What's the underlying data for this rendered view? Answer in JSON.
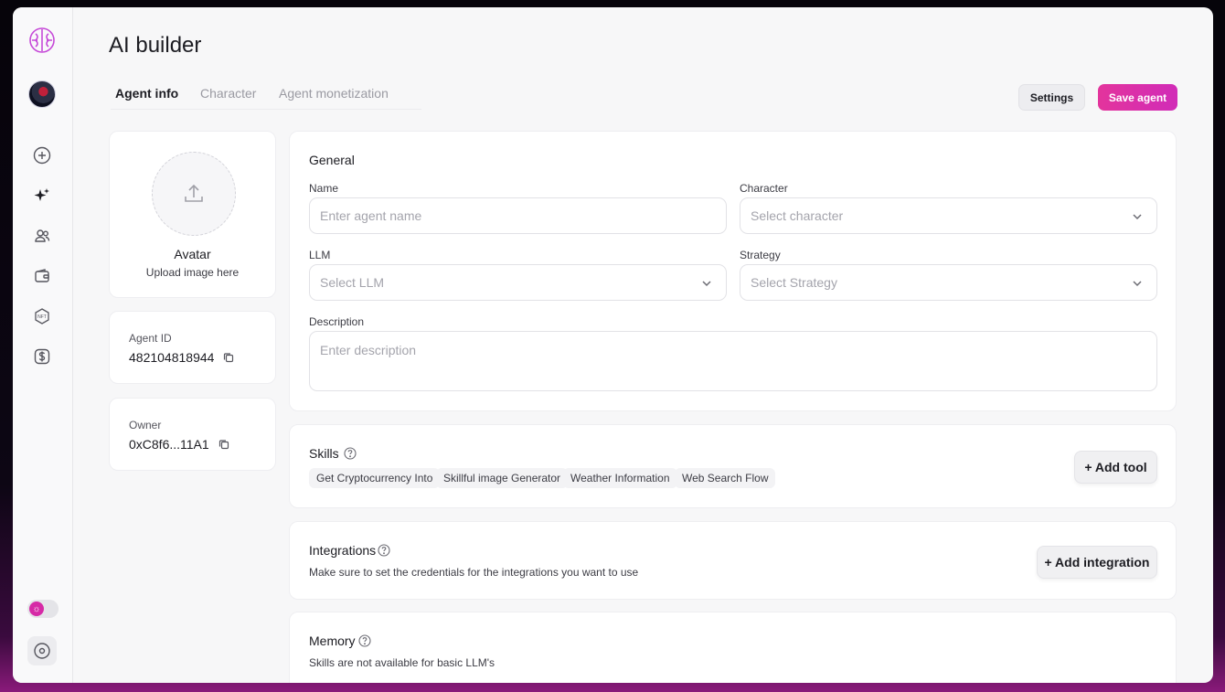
{
  "app": {
    "title": "AI builder"
  },
  "tabs": [
    {
      "label": "Agent info",
      "active": true
    },
    {
      "label": "Character",
      "active": false
    },
    {
      "label": "Agent monetization",
      "active": false
    }
  ],
  "header_buttons": {
    "settings": "Settings",
    "save": "Save agent"
  },
  "sidebar": {
    "icons": [
      "brain-logo-icon",
      "user-avatar",
      "plus-circle-icon",
      "sparkles-icon",
      "users-icon",
      "wallet-icon",
      "nft-icon",
      "dollar-icon",
      "theme-toggle",
      "settings-circle-icon"
    ]
  },
  "avatar_card": {
    "title": "Avatar",
    "subtitle": "Upload image here"
  },
  "agent_id": {
    "label": "Agent ID",
    "value": "482104818944"
  },
  "owner": {
    "label": "Owner",
    "value": "0xC8f6...11A1"
  },
  "general": {
    "title": "General",
    "name": {
      "label": "Name",
      "placeholder": "Enter agent name"
    },
    "character": {
      "label": "Character",
      "placeholder": "Select character"
    },
    "llm": {
      "label": "LLM",
      "placeholder": "Select LLM"
    },
    "strategy": {
      "label": "Strategy",
      "placeholder": "Select Strategy"
    },
    "description": {
      "label": "Description",
      "placeholder": "Enter description"
    }
  },
  "skills": {
    "title": "Skills",
    "items": [
      "Get Cryptocurrency Into",
      "Skillful image Generator",
      "Weather Information",
      "Web Search Flow"
    ],
    "add_button": "+ Add tool"
  },
  "integrations": {
    "title": "Integrations",
    "description": "Make sure to set the credentials for the integrations you want to use",
    "add_button": "+ Add integration"
  },
  "memory": {
    "title": "Memory",
    "description": "Skills are not available for basic LLM's"
  },
  "colors": {
    "accent": "#e3349c",
    "accent_secondary": "#d12cb8",
    "background": "#f7f7f8"
  }
}
